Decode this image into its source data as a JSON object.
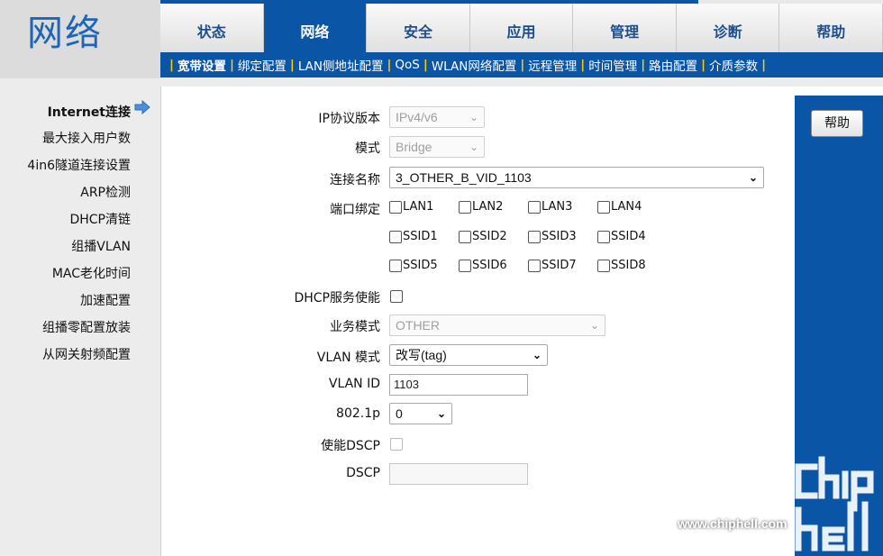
{
  "app": {
    "logo_text": "网络"
  },
  "tabs": [
    {
      "label": "状态",
      "active": false
    },
    {
      "label": "网络",
      "active": true
    },
    {
      "label": "安全",
      "active": false
    },
    {
      "label": "应用",
      "active": false
    },
    {
      "label": "管理",
      "active": false
    },
    {
      "label": "诊断",
      "active": false
    },
    {
      "label": "帮助",
      "active": false
    }
  ],
  "subnav": [
    "宽带设置",
    "绑定配置",
    "LAN侧地址配置",
    "QoS",
    "WLAN网络配置",
    "远程管理",
    "时间管理",
    "路由配置",
    "介质参数"
  ],
  "sidebar": {
    "items": [
      "Internet连接",
      "最大接入用户数",
      "4in6隧道连接设置",
      "ARP检测",
      "DHCP清链",
      "组播VLAN",
      "MAC老化时间",
      "加速配置",
      "组播零配置放装",
      "从网关射频配置"
    ],
    "active_index": 0
  },
  "form": {
    "ip_version": {
      "label": "IP协议版本",
      "value": "IPv4/v6"
    },
    "mode": {
      "label": "模式",
      "value": "Bridge"
    },
    "conn_name": {
      "label": "连接名称",
      "value": "3_OTHER_B_VID_1103"
    },
    "port_binding": {
      "label": "端口绑定",
      "ports": [
        "LAN1",
        "LAN2",
        "LAN3",
        "LAN4",
        "SSID1",
        "SSID2",
        "SSID3",
        "SSID4",
        "SSID5",
        "SSID6",
        "SSID7",
        "SSID8"
      ]
    },
    "dhcp": {
      "label": "DHCP服务使能"
    },
    "service_mode": {
      "label": "业务模式",
      "value": "OTHER"
    },
    "vlan_mode": {
      "label": "VLAN 模式",
      "value": "改写(tag)"
    },
    "vlan_id": {
      "label": "VLAN ID",
      "value": "1103"
    },
    "p8021": {
      "label": "802.1p",
      "value": "0"
    },
    "enable_dscp": {
      "label": "使能DSCP"
    },
    "dscp": {
      "label": "DSCP",
      "value": ""
    }
  },
  "help": {
    "button_label": "帮助"
  },
  "watermark": {
    "url": "www.chiphell.com"
  },
  "colors": {
    "brand": "#0b55a6",
    "logo": "#1e66b5",
    "subnav_separator": "#ffcc00"
  }
}
